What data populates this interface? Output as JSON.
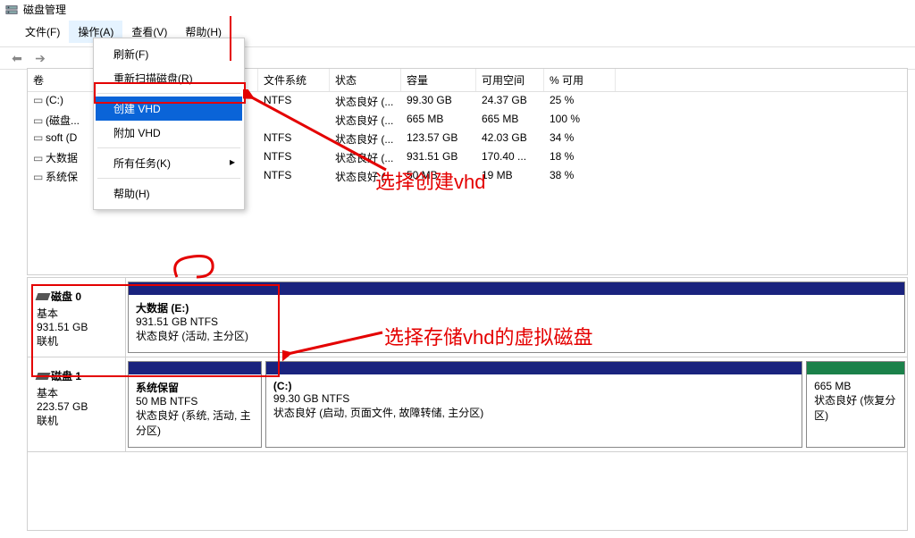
{
  "window": {
    "title": "磁盘管理"
  },
  "menu": {
    "file": "文件(F)",
    "action": "操作(A)",
    "view": "查看(V)",
    "help": "帮助(H)"
  },
  "dropdown": {
    "refresh": "刷新(F)",
    "rescan": "重新扫描磁盘(R)",
    "create_vhd": "创建 VHD",
    "attach_vhd": "附加 VHD",
    "all_tasks": "所有任务(K)",
    "help": "帮助(H)"
  },
  "columns": {
    "volume": "卷",
    "fs": "文件系统",
    "status": "状态",
    "capacity": "容量",
    "free": "可用空间",
    "pct": "% 可用"
  },
  "volumes": [
    {
      "name": "(C:)",
      "fs": "NTFS",
      "status": "状态良好 (...",
      "cap": "99.30 GB",
      "free": "24.37 GB",
      "pct": "25 %"
    },
    {
      "name": "(磁盘...",
      "fs": "",
      "status": "状态良好 (...",
      "cap": "665 MB",
      "free": "665 MB",
      "pct": "100 %"
    },
    {
      "name": "soft (D",
      "fs": "NTFS",
      "status": "状态良好 (...",
      "cap": "123.57 GB",
      "free": "42.03 GB",
      "pct": "34 %"
    },
    {
      "name": "大数据",
      "fs": "NTFS",
      "status": "状态良好 (...",
      "cap": "931.51 GB",
      "free": "170.40 ...",
      "pct": "18 %"
    },
    {
      "name": "系统保",
      "fs": "NTFS",
      "status": "状态良好 (...",
      "cap": "50 MB",
      "free": "19 MB",
      "pct": "38 %"
    }
  ],
  "disks": [
    {
      "name": "磁盘 0",
      "type": "基本",
      "size": "931.51 GB",
      "state": "联机",
      "partitions": [
        {
          "title": "大数据  (E:)",
          "line2": "931.51 GB NTFS",
          "line3": "状态良好 (活动, 主分区)",
          "stripe": "blue",
          "flex": 1
        }
      ]
    },
    {
      "name": "磁盘 1",
      "type": "基本",
      "size": "223.57 GB",
      "state": "联机",
      "partitions": [
        {
          "title": "系统保留",
          "line2": "50 MB NTFS",
          "line3": "状态良好 (系统, 活动, 主分区)",
          "stripe": "blue",
          "flex": 0.19
        },
        {
          "title": "(C:)",
          "line2": "99.30 GB NTFS",
          "line3": "状态良好 (启动, 页面文件, 故障转储, 主分区)",
          "stripe": "blue",
          "flex": 0.77
        },
        {
          "title": "",
          "line2": "665 MB",
          "line3": "状态良好 (恢复分区)",
          "stripe": "green",
          "flex": 0.14
        }
      ]
    }
  ],
  "annotations": {
    "create_vhd_label": "选择创建vhd",
    "select_disk_label": "选择存储vhd的虚拟磁盘"
  }
}
